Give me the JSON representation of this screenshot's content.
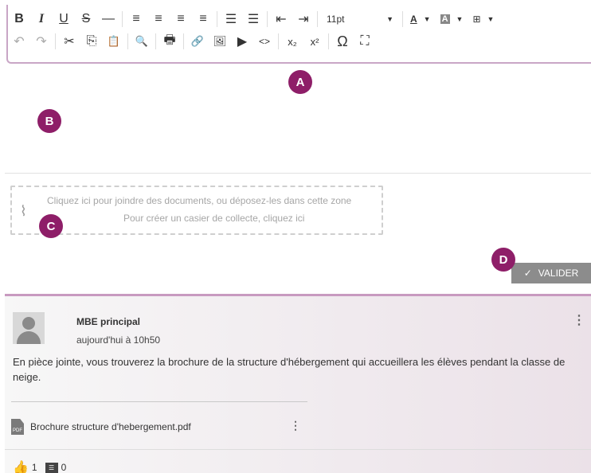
{
  "toolbar": {
    "row1": {
      "bold": "B",
      "italic": "I",
      "underline": "U",
      "strike": "S",
      "hr": "—",
      "align_left": "≡",
      "align_center": "≡",
      "align_right": "≡",
      "justify": "≡",
      "bullets": "☰",
      "numbers": "☰",
      "outdent": "⇤",
      "indent": "⇥",
      "font_size": "11pt",
      "text_color": "A",
      "bg_color": "A",
      "table": "⊞"
    },
    "row2": {
      "undo": "↶",
      "redo": "↷",
      "cut": "✂",
      "copy": "⎘",
      "paste": "📋",
      "find": "🔍",
      "print": "🖶",
      "link": "🔗",
      "image": "🖼",
      "media": "▶",
      "code": "<>",
      "subscript": "x₂",
      "superscript": "x²",
      "special_char": "Ω",
      "fullscreen": "⛶"
    }
  },
  "badges": {
    "a": "A",
    "b": "B",
    "c": "C",
    "d": "D"
  },
  "attach": {
    "line1": "Cliquez ici pour joindre des documents, ou déposez-les dans cette zone",
    "line2": "Pour créer un casier de collecte, cliquez ici"
  },
  "valider": {
    "check": "✓",
    "label": "VALIDER"
  },
  "post": {
    "author": "MBE principal",
    "time": "aujourd'hui à 10h50",
    "message": "En pièce jointe, vous trouverez la brochure de la structure d'hébergement qui accueillera les élèves pendant la classe de neige.",
    "file": "Brochure structure d'hebergement.pdf",
    "file_icon_text": "PDF",
    "likes": "1",
    "comments": "0",
    "kebab": "⋮"
  },
  "colors": {
    "accent": "#8e1e68",
    "border": "#c9a6c6",
    "button": "#8c8c8c"
  }
}
